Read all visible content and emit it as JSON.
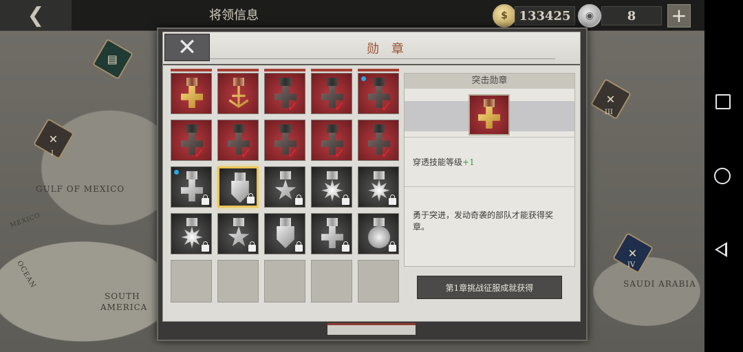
{
  "header": {
    "title": "将领信息",
    "gold_amount": "133425",
    "medal_amount": "8",
    "gold_coin_icon": "gold-coin-icon",
    "silver_coin_icon": "silver-coin-icon"
  },
  "map": {
    "labels": [
      "GULF OF MEXICO",
      "SOUTH",
      "AMERICA",
      "SAUDI ARABIA",
      "MEXICO",
      "OCEAN"
    ],
    "markers": [
      "I",
      "III",
      "IV"
    ]
  },
  "modal": {
    "title": "勋 章",
    "selected_medal": {
      "name": "突击勋章",
      "stat_label": "穿透技能等级",
      "stat_value": "+1",
      "description": "勇于突进，发动奇袭的部队才能获得奖章。",
      "obtain_text": "第1章挑战征服成就获得"
    },
    "medals": [
      {
        "row": 0,
        "col": 0,
        "bg": "red",
        "shape": "gold-cross",
        "ribbon": "rib-red",
        "status": "none",
        "dot": false
      },
      {
        "row": 0,
        "col": 1,
        "bg": "red",
        "shape": "gold-anchor",
        "ribbon": "rib-red",
        "status": "none",
        "dot": false
      },
      {
        "row": 0,
        "col": 2,
        "bg": "red",
        "shape": "grey-cross",
        "ribbon": "rib-dark",
        "status": "check",
        "dot": false
      },
      {
        "row": 0,
        "col": 3,
        "bg": "red",
        "shape": "grey-cross",
        "ribbon": "rib-dark",
        "status": "check",
        "dot": false
      },
      {
        "row": 0,
        "col": 4,
        "bg": "red",
        "shape": "grey-cross",
        "ribbon": "rib-dark",
        "status": "check",
        "dot": true
      },
      {
        "row": 1,
        "col": 0,
        "bg": "red",
        "shape": "grey-cross",
        "ribbon": "rib-dark",
        "status": "check",
        "dot": false
      },
      {
        "row": 1,
        "col": 1,
        "bg": "red",
        "shape": "grey-cross",
        "ribbon": "rib-dark",
        "status": "check",
        "dot": false
      },
      {
        "row": 1,
        "col": 2,
        "bg": "red",
        "shape": "grey-cross",
        "ribbon": "rib-dark",
        "status": "check",
        "dot": false
      },
      {
        "row": 1,
        "col": 3,
        "bg": "red",
        "shape": "grey-cross",
        "ribbon": "rib-dark",
        "status": "check",
        "dot": false
      },
      {
        "row": 1,
        "col": 4,
        "bg": "red",
        "shape": "grey-cross",
        "ribbon": "rib-dark",
        "status": "check",
        "dot": false
      },
      {
        "row": 2,
        "col": 0,
        "bg": "dark",
        "shape": "silver-cross",
        "ribbon": "rib-white",
        "status": "lock",
        "dot": true
      },
      {
        "row": 2,
        "col": 1,
        "bg": "dark",
        "shape": "silver-shield",
        "ribbon": "rib-white",
        "status": "lock",
        "dot": false,
        "selected": true
      },
      {
        "row": 2,
        "col": 2,
        "bg": "dark",
        "shape": "silver-star",
        "ribbon": "rib-white",
        "status": "lock",
        "dot": false
      },
      {
        "row": 2,
        "col": 3,
        "bg": "dark",
        "shape": "silver-sun",
        "ribbon": "rib-white",
        "status": "lock",
        "dot": false
      },
      {
        "row": 2,
        "col": 4,
        "bg": "dark",
        "shape": "silver-sun",
        "ribbon": "rib-white",
        "status": "lock",
        "dot": false
      },
      {
        "row": 3,
        "col": 0,
        "bg": "dark",
        "shape": "silver-sun",
        "ribbon": "rib-white",
        "status": "lock",
        "dot": false
      },
      {
        "row": 3,
        "col": 1,
        "bg": "dark",
        "shape": "silver-star",
        "ribbon": "rib-white",
        "status": "lock",
        "dot": false
      },
      {
        "row": 3,
        "col": 2,
        "bg": "dark",
        "shape": "silver-shield",
        "ribbon": "rib-white",
        "status": "lock",
        "dot": false
      },
      {
        "row": 3,
        "col": 3,
        "bg": "dark",
        "shape": "silver-cross",
        "ribbon": "rib-white",
        "status": "lock",
        "dot": false
      },
      {
        "row": 3,
        "col": 4,
        "bg": "dark",
        "shape": "silver-circle",
        "ribbon": "rib-white",
        "status": "lock",
        "dot": false
      },
      {
        "row": 4,
        "col": 0,
        "bg": "empty",
        "status": "none"
      },
      {
        "row": 4,
        "col": 1,
        "bg": "empty",
        "status": "none"
      },
      {
        "row": 4,
        "col": 2,
        "bg": "empty",
        "status": "none"
      },
      {
        "row": 4,
        "col": 3,
        "bg": "empty",
        "status": "none"
      },
      {
        "row": 4,
        "col": 4,
        "bg": "empty",
        "status": "none"
      }
    ]
  },
  "colors": {
    "title_accent": "#9a5436",
    "check_red": "#e1262d",
    "new_dot": "#2ba6e6",
    "selected_border": "#e9c55a",
    "stat_plus_green": "#2f9a3a"
  }
}
